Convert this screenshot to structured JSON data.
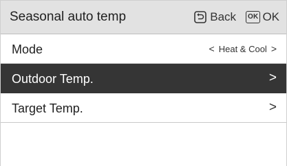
{
  "header": {
    "title": "Seasonal auto temp",
    "back_label": "Back",
    "ok_icon_text": "OK",
    "ok_label": "OK"
  },
  "rows": [
    {
      "label": "Mode",
      "value": "Heat & Cool",
      "prev_glyph": "<",
      "next_glyph": ">"
    },
    {
      "label": "Outdoor Temp.",
      "next_glyph": ">",
      "selected": true
    },
    {
      "label": "Target Temp.",
      "next_glyph": ">"
    }
  ],
  "colors": {
    "header_bg": "#e2e2e2",
    "selected_bg": "#353535",
    "text": "#1f1f1f"
  },
  "icons": {
    "back": "back-arrow-box-icon",
    "ok": "ok-box-icon"
  }
}
